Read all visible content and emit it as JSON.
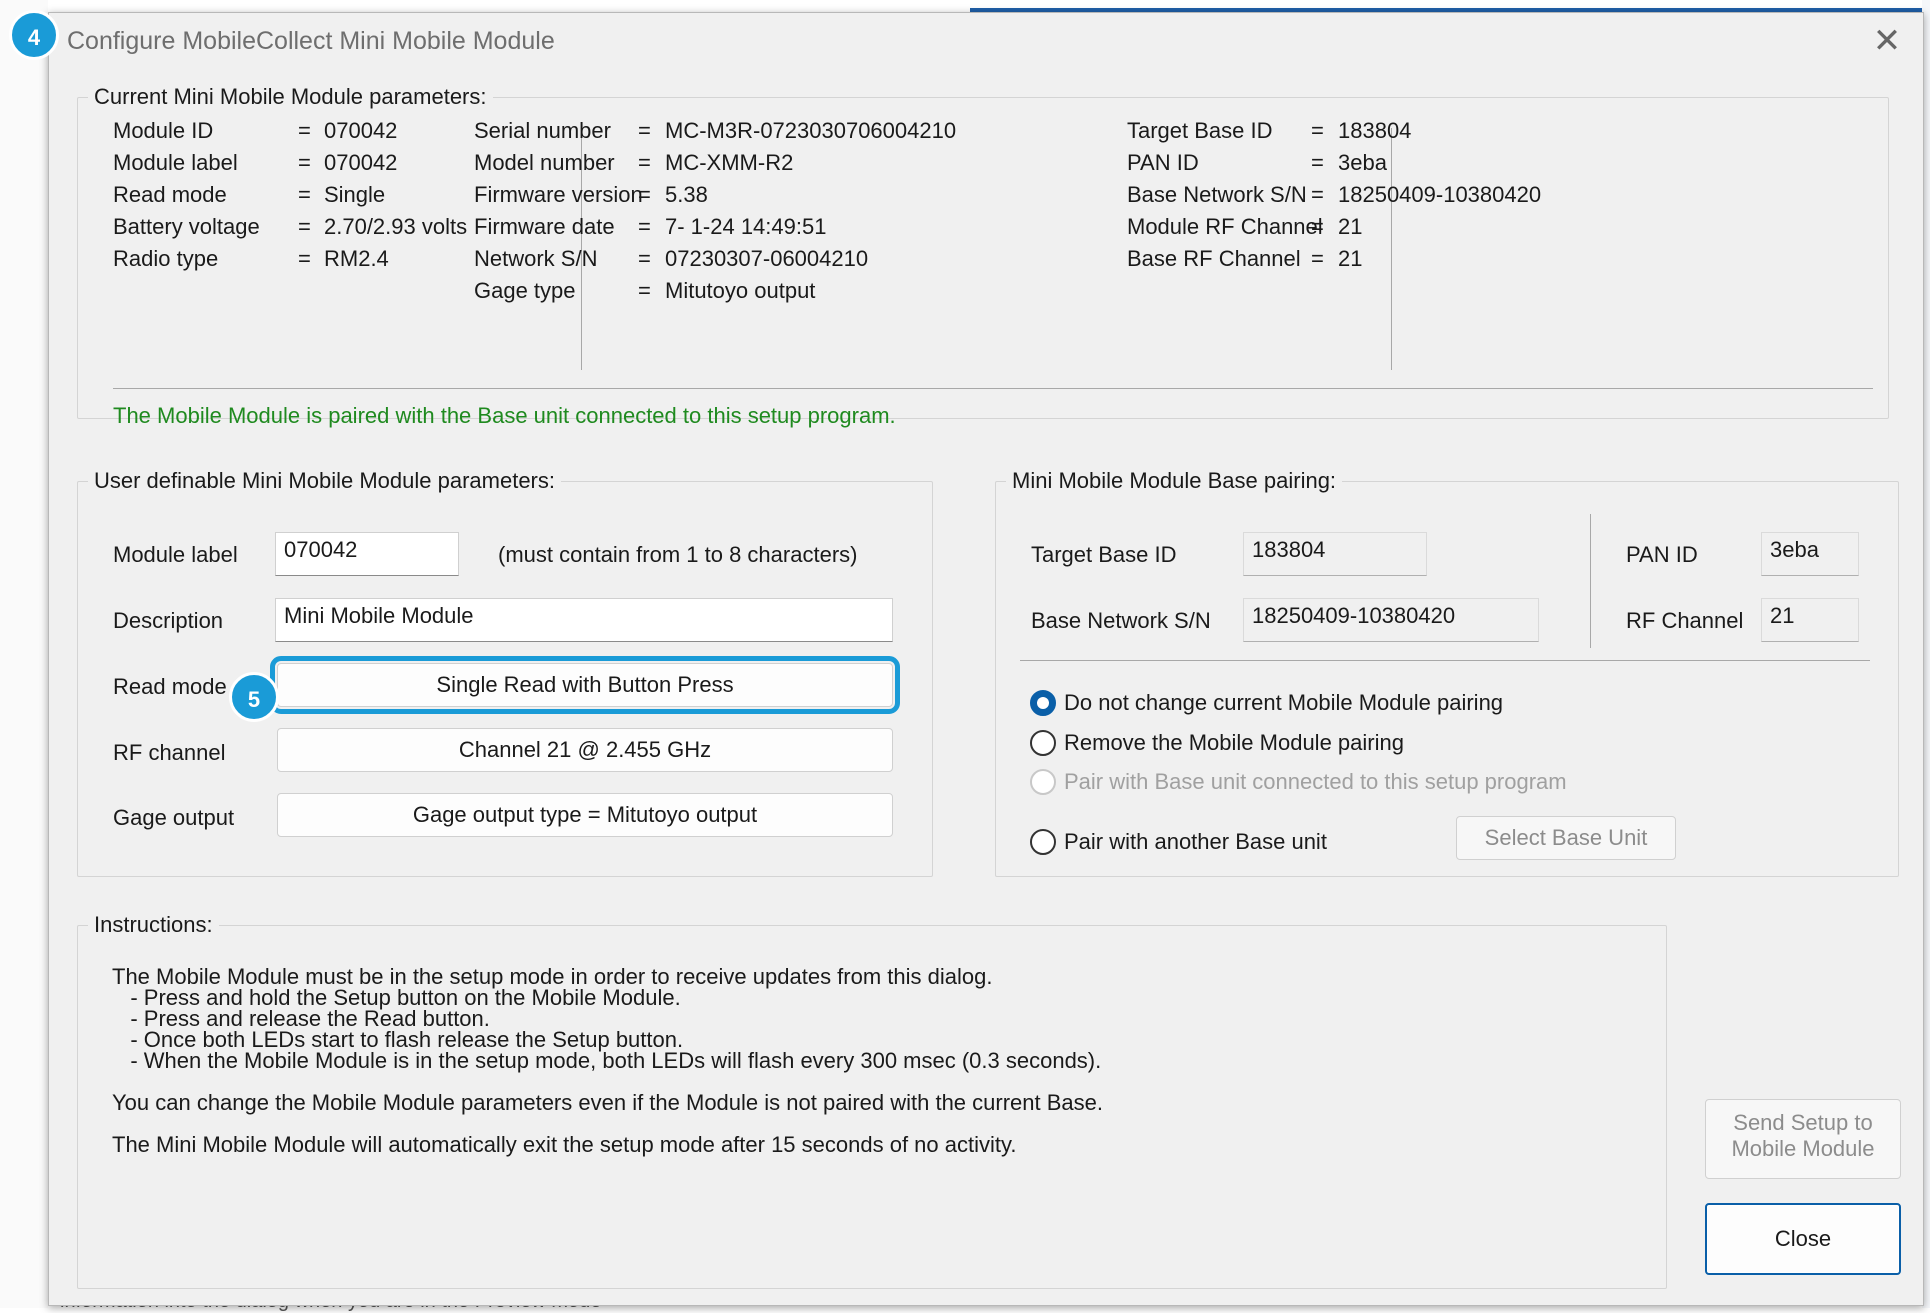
{
  "window": {
    "title": "Configure MobileCollect Mini Mobile Module",
    "close_symbol": "✕"
  },
  "badges": {
    "step4": "4",
    "step5": "5"
  },
  "background": {
    "footer_text": "information into the dialog when you are in the Preview mode"
  },
  "current": {
    "group_title": "Current Mini Mobile Module parameters:",
    "col1": [
      {
        "label": "Module ID",
        "eq": "=",
        "value": "070042"
      },
      {
        "label": "Module label",
        "eq": "=",
        "value": "070042"
      },
      {
        "label": "Read mode",
        "eq": "=",
        "value": "Single"
      },
      {
        "label": "Battery voltage",
        "eq": "=",
        "value": "2.70/2.93 volts"
      },
      {
        "label": "Radio type",
        "eq": "=",
        "value": "RM2.4"
      }
    ],
    "col2": [
      {
        "label": "Serial number",
        "eq": "=",
        "value": "MC-M3R-0723030706004210"
      },
      {
        "label": "Model number",
        "eq": "=",
        "value": "MC-XMM-R2"
      },
      {
        "label": "Firmware version",
        "eq": "=",
        "value": "5.38"
      },
      {
        "label": "Firmware date",
        "eq": "=",
        "value": " 7- 1-24   14:49:51"
      },
      {
        "label": "Network S/N",
        "eq": "=",
        "value": "07230307-06004210"
      },
      {
        "label": "Gage type",
        "eq": "=",
        "value": "Mitutoyo output"
      }
    ],
    "col3": [
      {
        "label": "Target Base ID",
        "eq": "=",
        "value": "183804"
      },
      {
        "label": "PAN ID",
        "eq": "=",
        "value": "3eba"
      },
      {
        "label": "Base Network S/N",
        "eq": "=",
        "value": "18250409-10380420"
      },
      {
        "label": "Module RF Channel",
        "eq": "=",
        "value": "21"
      },
      {
        "label": "Base RF Channel",
        "eq": "=",
        "value": "21"
      }
    ],
    "paired_message": "The Mobile Module is paired with the Base unit connected to this setup program.",
    "status_color": "#1f8a1f"
  },
  "user": {
    "group_title": "User definable Mini Mobile Module parameters:",
    "module_label": {
      "label": "Module label",
      "value": "070042",
      "hint": "(must contain from 1 to 8 characters)"
    },
    "description": {
      "label": "Description",
      "value": "Mini Mobile Module"
    },
    "read_mode": {
      "label": "Read mode",
      "value": "Single Read with Button Press"
    },
    "rf_channel": {
      "label": "RF channel",
      "value": "Channel 21 @ 2.455 GHz"
    },
    "gage_output": {
      "label": "Gage output",
      "value": "Gage output type = Mitutoyo output"
    },
    "highlight_color": "#1a9bd7"
  },
  "pairing": {
    "group_title": "Mini Mobile Module Base pairing:",
    "target_base_id": {
      "label": "Target Base ID",
      "value": "183804"
    },
    "base_network_sn": {
      "label": "Base Network S/N",
      "value": "18250409-10380420"
    },
    "pan_id": {
      "label": "PAN ID",
      "value": "3eba"
    },
    "rf_channel": {
      "label": "RF Channel",
      "value": "21"
    },
    "options": [
      {
        "label": "Do not change current Mobile Module pairing",
        "checked": true,
        "enabled": true
      },
      {
        "label": "Remove the Mobile Module pairing",
        "checked": false,
        "enabled": true
      },
      {
        "label": "Pair with Base unit connected to this setup program",
        "checked": false,
        "enabled": false
      },
      {
        "label": "Pair with another Base unit",
        "checked": false,
        "enabled": true
      }
    ],
    "select_base_button": "Select Base Unit"
  },
  "instructions": {
    "group_title": "Instructions:",
    "text": "The Mobile Module must be in the setup mode in order to receive updates from this dialog.\n   - Press and hold the Setup button on the Mobile Module.\n   - Press and release the Read button.\n   - Once both LEDs start to flash release the Setup button.\n   - When the Mobile Module is in the setup mode, both LEDs will flash every 300 msec (0.3 seconds).\n\nYou can change the Mobile Module parameters even if the Module is not paired with the current Base.\n\nThe Mini Mobile Module will automatically exit the setup mode after 15 seconds of no activity."
  },
  "buttons": {
    "send_setup_line1": "Send Setup to",
    "send_setup_line2": "Mobile Module",
    "close": "Close"
  }
}
